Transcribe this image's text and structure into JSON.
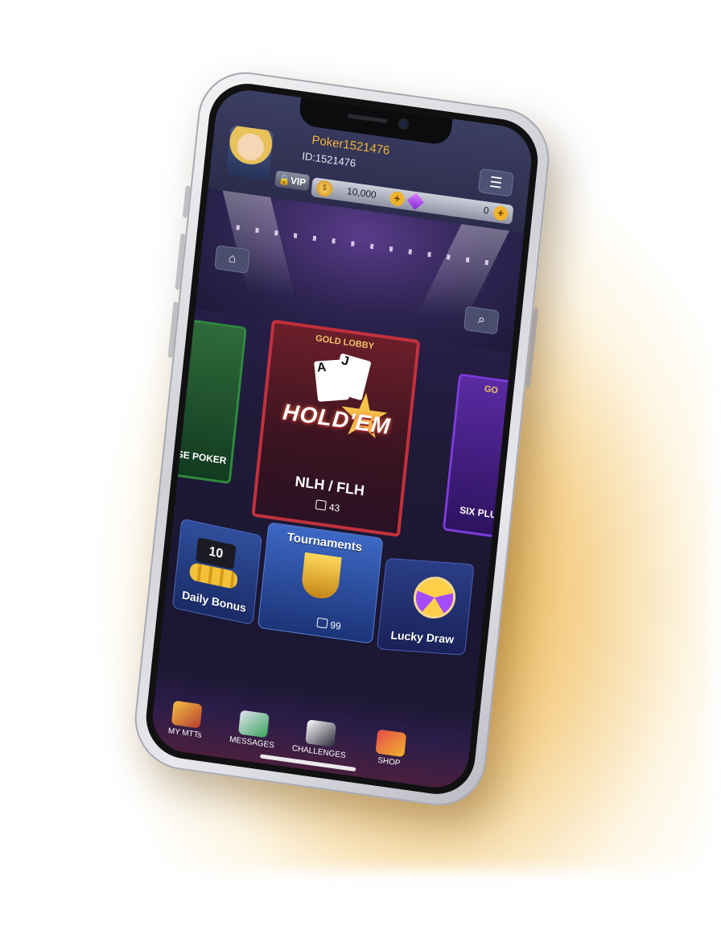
{
  "header": {
    "username": "Poker1521476",
    "user_id": "ID:1521476",
    "vip_label": "VIP",
    "menu_icon": "hamburger-icon"
  },
  "currency": {
    "coins": "10,000",
    "gems": "0",
    "coin_icon": "coin-icon",
    "gem_icon": "gem-icon"
  },
  "stage": {
    "home_icon": "home-icon",
    "search_icon": "search-icon"
  },
  "lobbies": {
    "left": {
      "label": "ESE POKER"
    },
    "main": {
      "tier": "GOLD LOBBY",
      "art_title": "HOLD'EM",
      "game_type": "NLH / FLH",
      "players": "43"
    },
    "right": {
      "tier": "GO",
      "label": "SIX PLU"
    }
  },
  "tiles": {
    "daily_bonus": {
      "label": "Daily Bonus",
      "clock_text": "10"
    },
    "tournaments": {
      "label": "Tournaments",
      "players": "99"
    },
    "lucky_draw": {
      "label": "Lucky Draw"
    }
  },
  "nav": [
    {
      "label": "MY MTTs",
      "icon": "tournament-icon"
    },
    {
      "label": "MESSAGES",
      "icon": "mailbox-icon"
    },
    {
      "label": "CHALLENGES",
      "icon": "cards-icon"
    },
    {
      "label": "SHOP",
      "icon": "shopping-cart-icon"
    }
  ]
}
